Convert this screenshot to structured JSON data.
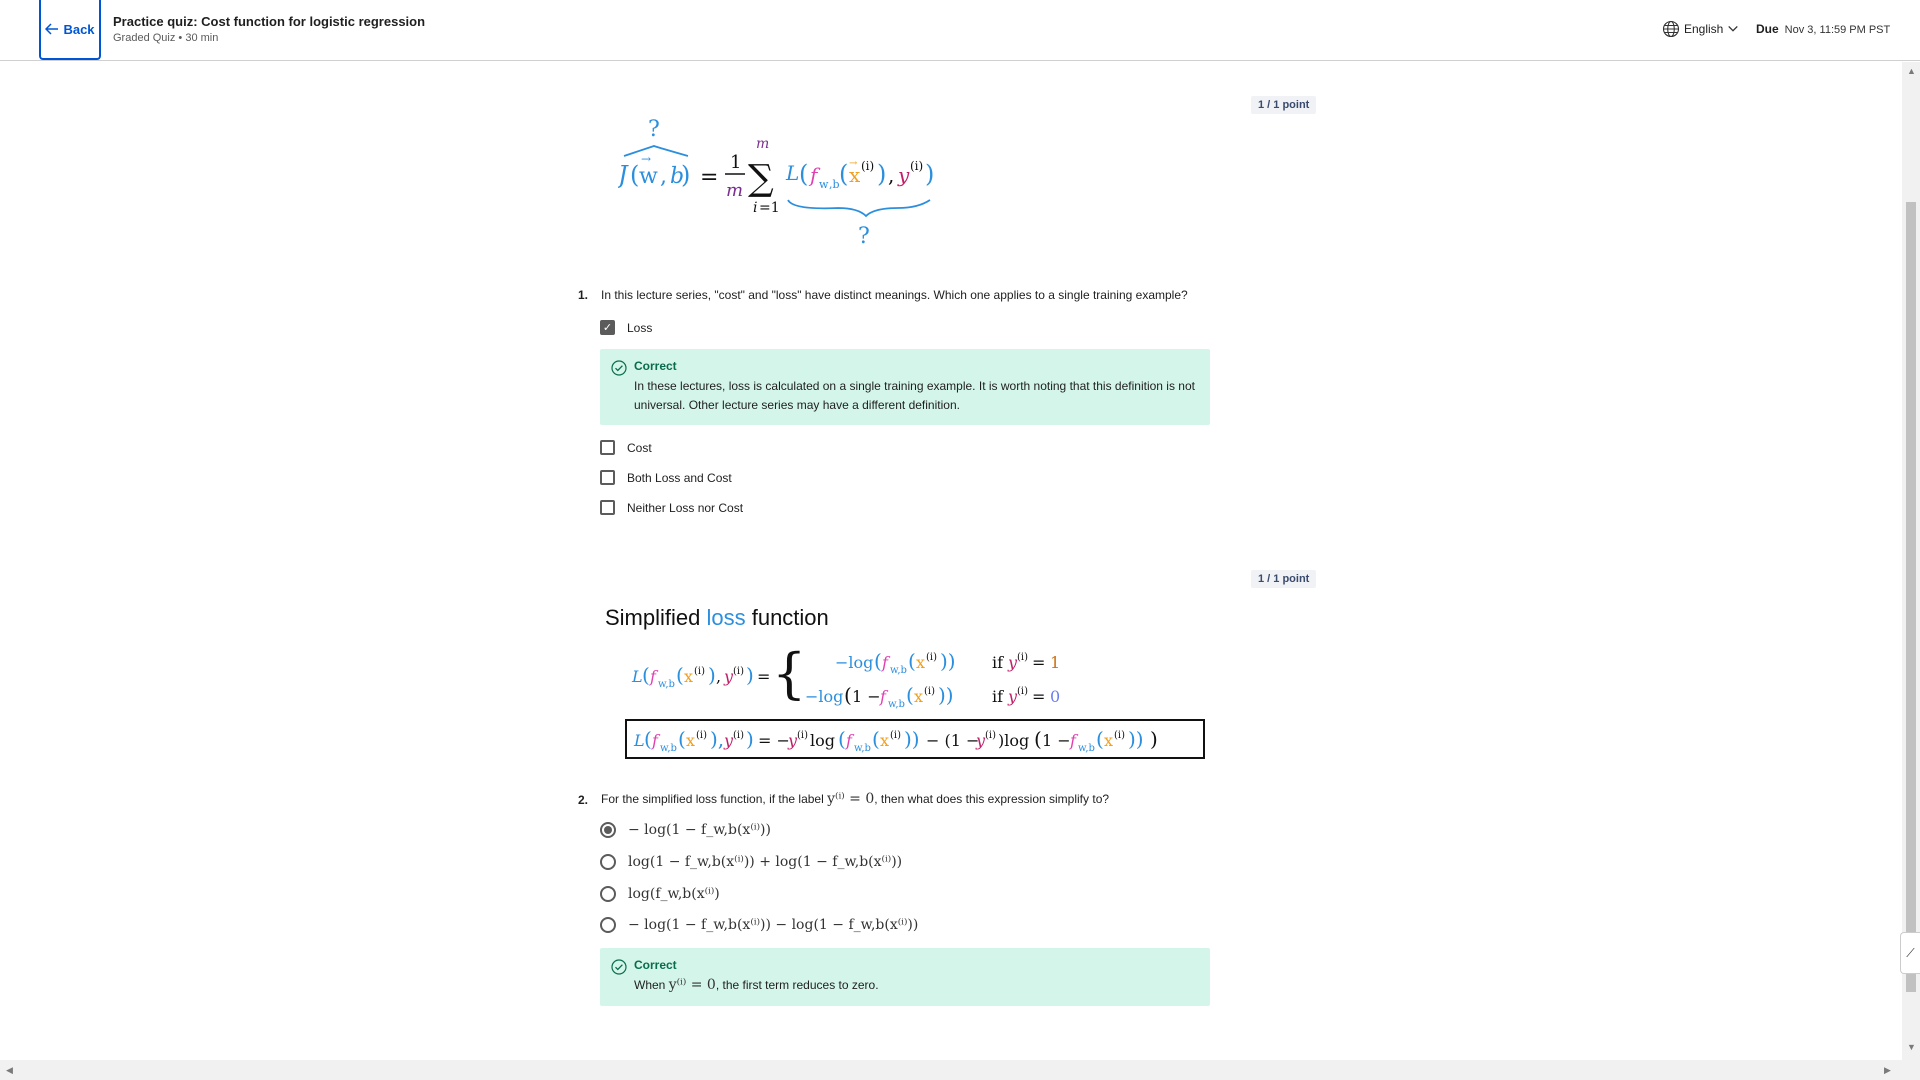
{
  "header": {
    "back_label": "Back",
    "quiz_title": "Practice quiz: Cost function for logistic regression",
    "quiz_subtitle": "Graded Quiz • 30 min",
    "language": "English",
    "due_label": "Due",
    "due_date": "Nov 3, 11:59 PM PST"
  },
  "colors": {
    "brand": "#0056d2",
    "correct_bg": "#d4f5ea",
    "correct_text": "#0a6c4d"
  },
  "q1": {
    "points": "1 / 1 point",
    "number": "1.",
    "text": "In this lecture series, \"cost\" and \"loss\" have distinct meanings. Which one applies to a single training example?",
    "options": [
      {
        "label": "Loss",
        "checked": true
      },
      {
        "label": "Cost",
        "checked": false
      },
      {
        "label": "Both Loss and Cost",
        "checked": false
      },
      {
        "label": "Neither Loss nor Cost",
        "checked": false
      }
    ],
    "feedback_title": "Correct",
    "feedback_text": "In these lectures, loss is calculated on a single training example. It is worth noting that this definition is not universal. Other lecture series may have a different definition."
  },
  "q2": {
    "points": "1 / 1 point",
    "image_title_pre": "Simplified ",
    "image_title_highlight": "loss",
    "image_title_post": " function",
    "number": "2.",
    "text_pre": "For the simplified loss function, if the label ",
    "text_math": "y⁽ⁱ⁾ = 0",
    "text_post": ", then what does this expression simplify to?",
    "options": [
      {
        "label": "− log(1 − f_w,b(x⁽ⁱ⁾))",
        "checked": true
      },
      {
        "label": "log(1 − f_w,b(x⁽ⁱ⁾)) + log(1 − f_w,b(x⁽ⁱ⁾))",
        "checked": false
      },
      {
        "label": "log(f_w,b(x⁽ⁱ⁾)",
        "checked": false
      },
      {
        "label": "− log(1 − f_w,b(x⁽ⁱ⁾)) − log(1 − f_w,b(x⁽ⁱ⁾))",
        "checked": false
      }
    ],
    "feedback_title": "Correct",
    "feedback_pre": "When ",
    "feedback_math": "y⁽ⁱ⁾ = 0",
    "feedback_post": ", the first term reduces to zero."
  }
}
